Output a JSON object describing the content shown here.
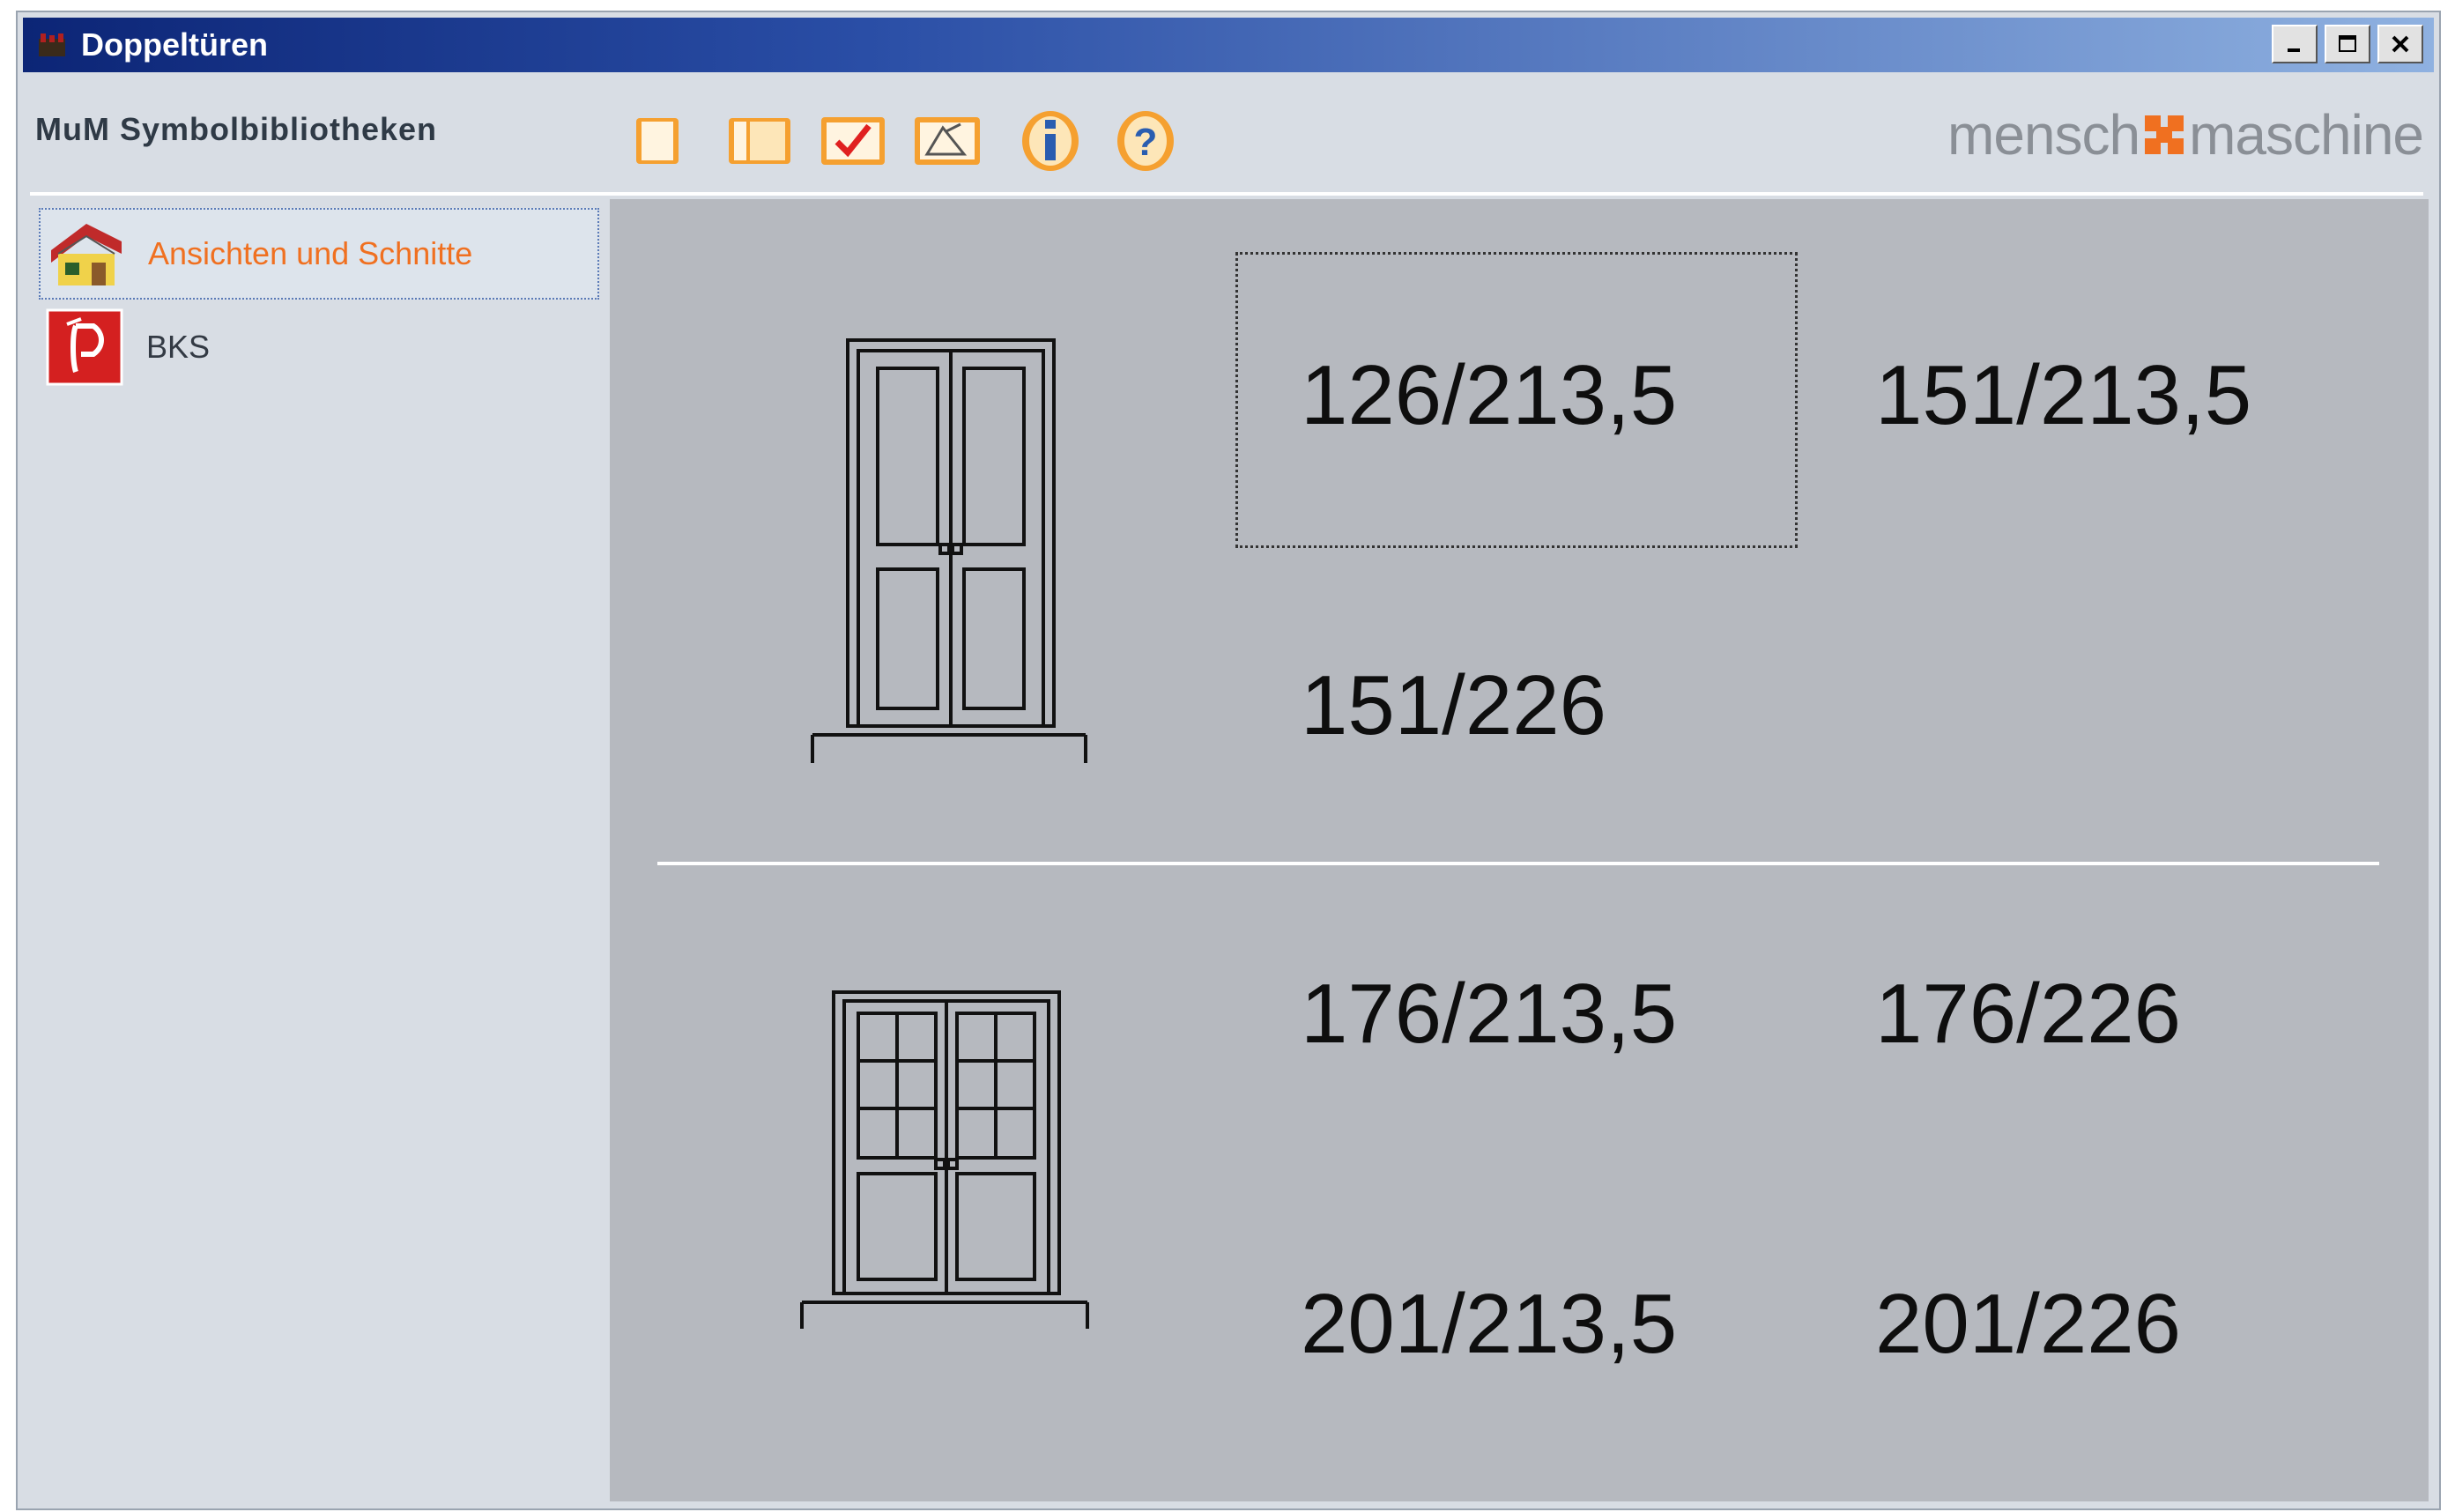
{
  "window": {
    "title": "Doppeltüren"
  },
  "toolbar": {
    "label": "MuM Symbolbibliotheken",
    "buttons": [
      "blank-page-icon",
      "book-icon",
      "checkmark-icon",
      "edit-drawing-icon",
      "info-icon",
      "help-icon"
    ],
    "brand_left": "mensch",
    "brand_right": "maschine",
    "brand_accent": "#f07020"
  },
  "sidebar": {
    "items": [
      {
        "label": "Ansichten und Schnitte",
        "icon": "house-icon",
        "selected": true
      },
      {
        "label": "BKS",
        "icon": "fire-extinguisher-icon",
        "selected": false
      }
    ]
  },
  "content": {
    "group1": {
      "door_icon": "double-door-panels-icon",
      "sizes": [
        "126/213,5",
        "151/213,5",
        "151/226"
      ],
      "selected_size": "126/213,5"
    },
    "group2": {
      "door_icon": "double-door-glazed-icon",
      "sizes": [
        "176/213,5",
        "176/226",
        "201/213,5",
        "201/226"
      ]
    }
  }
}
